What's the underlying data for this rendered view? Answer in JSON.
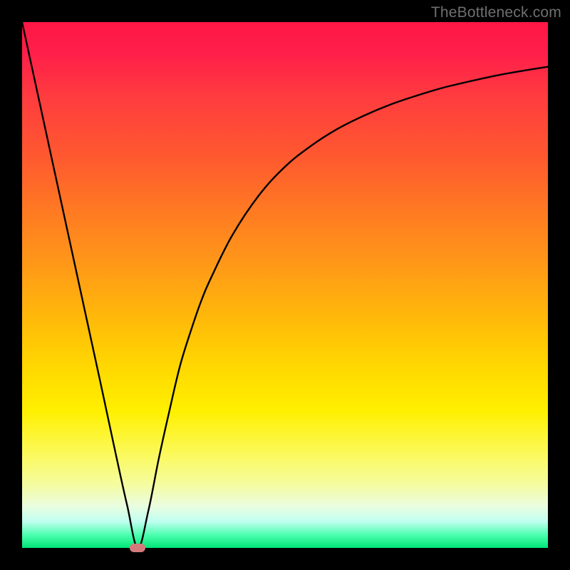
{
  "watermark": "TheBottleneck.com",
  "chart_data": {
    "type": "line",
    "title": "",
    "xlabel": "",
    "ylabel": "",
    "xlim": [
      0,
      100
    ],
    "ylim": [
      0,
      100
    ],
    "grid": false,
    "legend": false,
    "series": [
      {
        "name": "curve",
        "x": [
          0,
          5,
          10,
          15,
          18,
          20,
          22,
          24,
          26,
          28,
          30,
          32,
          34,
          36,
          40,
          45,
          50,
          55,
          60,
          65,
          70,
          75,
          80,
          85,
          90,
          95,
          100
        ],
        "y": [
          100,
          77,
          54,
          31,
          17,
          8,
          0,
          7,
          17,
          26,
          34.5,
          41,
          46.8,
          51.5,
          59.5,
          67,
          72.5,
          76.5,
          79.7,
          82.2,
          84.3,
          86,
          87.5,
          88.7,
          89.8,
          90.7,
          91.5
        ]
      }
    ],
    "marker": {
      "x": 22,
      "y": 0
    },
    "colors": {
      "curve": "#000000",
      "marker": "#d47a7a",
      "gradient_top": "#ff1744",
      "gradient_bottom": "#00e676"
    }
  }
}
